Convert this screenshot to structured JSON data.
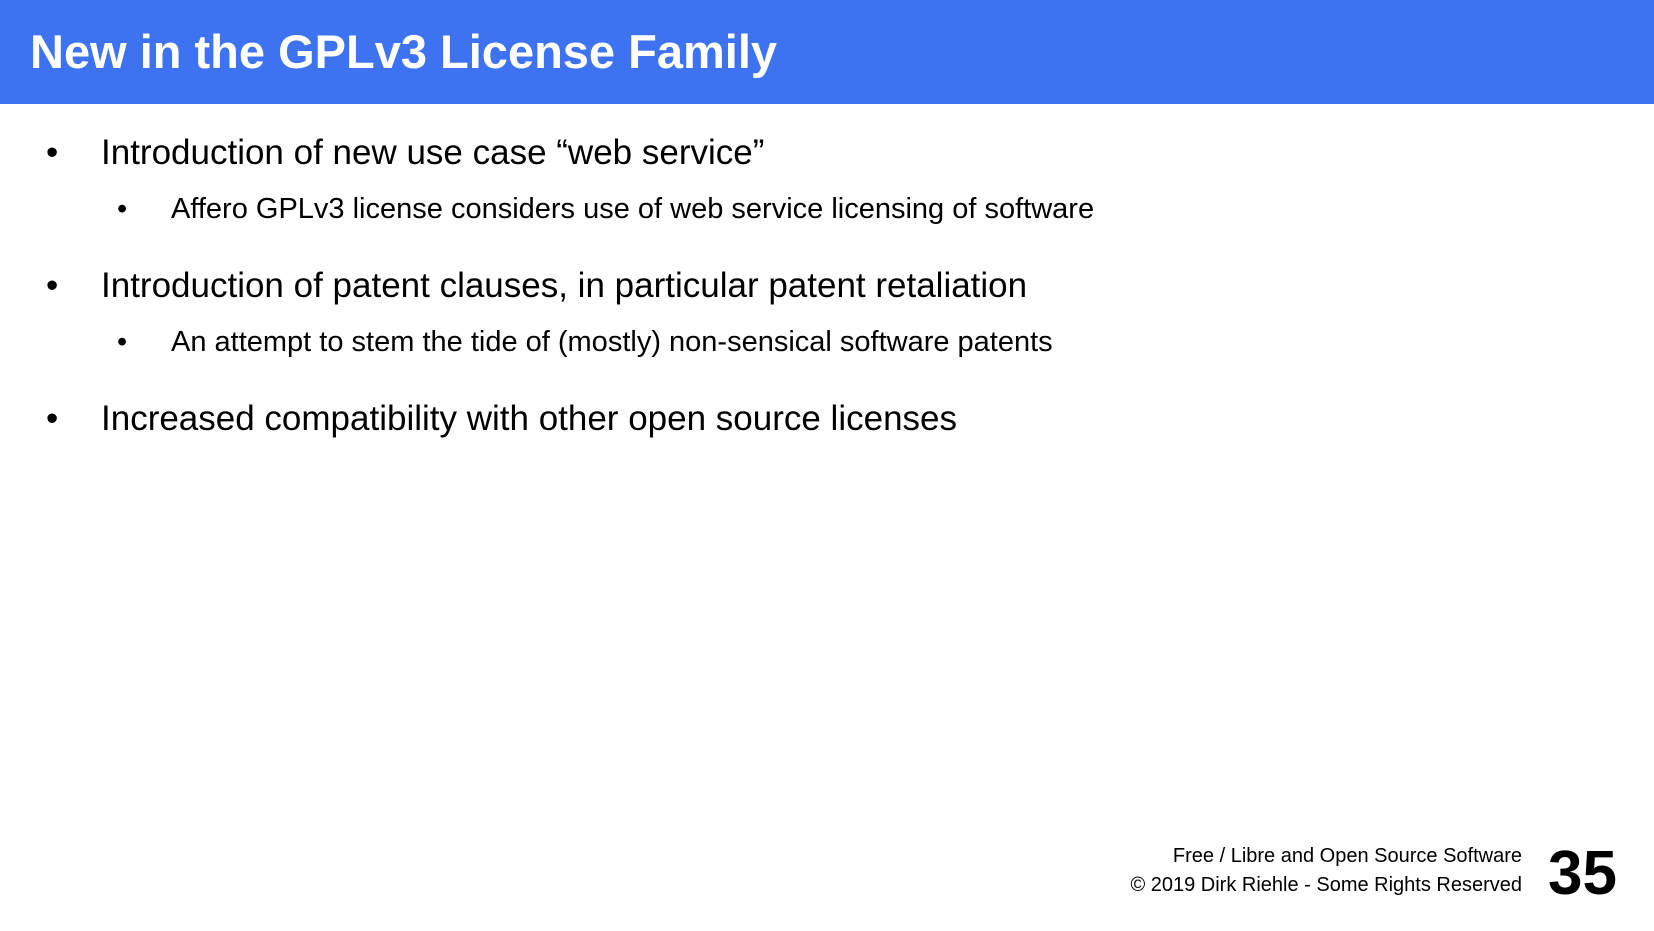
{
  "slide": {
    "title": "New in the GPLv3 License Family",
    "bullet_symbol": "•",
    "bullets": [
      {
        "text": "Introduction of new use case “web service”",
        "sub": [
          "Affero GPLv3 license considers use of web service licensing of software"
        ]
      },
      {
        "text": "Introduction of patent clauses, in particular patent retaliation",
        "sub": [
          "An attempt to stem the tide of (mostly) non-sensical software patents"
        ]
      },
      {
        "text": "Increased compatibility with other open source licenses",
        "sub": []
      }
    ],
    "footer": {
      "line1": "Free / Libre and Open Source Software",
      "line2": "© 2019 Dirk Riehle - Some Rights Reserved",
      "page_number": "35"
    }
  },
  "colors": {
    "title_bar": "#3d72f0",
    "title_text": "#ffffff",
    "body_text": "#000000"
  }
}
